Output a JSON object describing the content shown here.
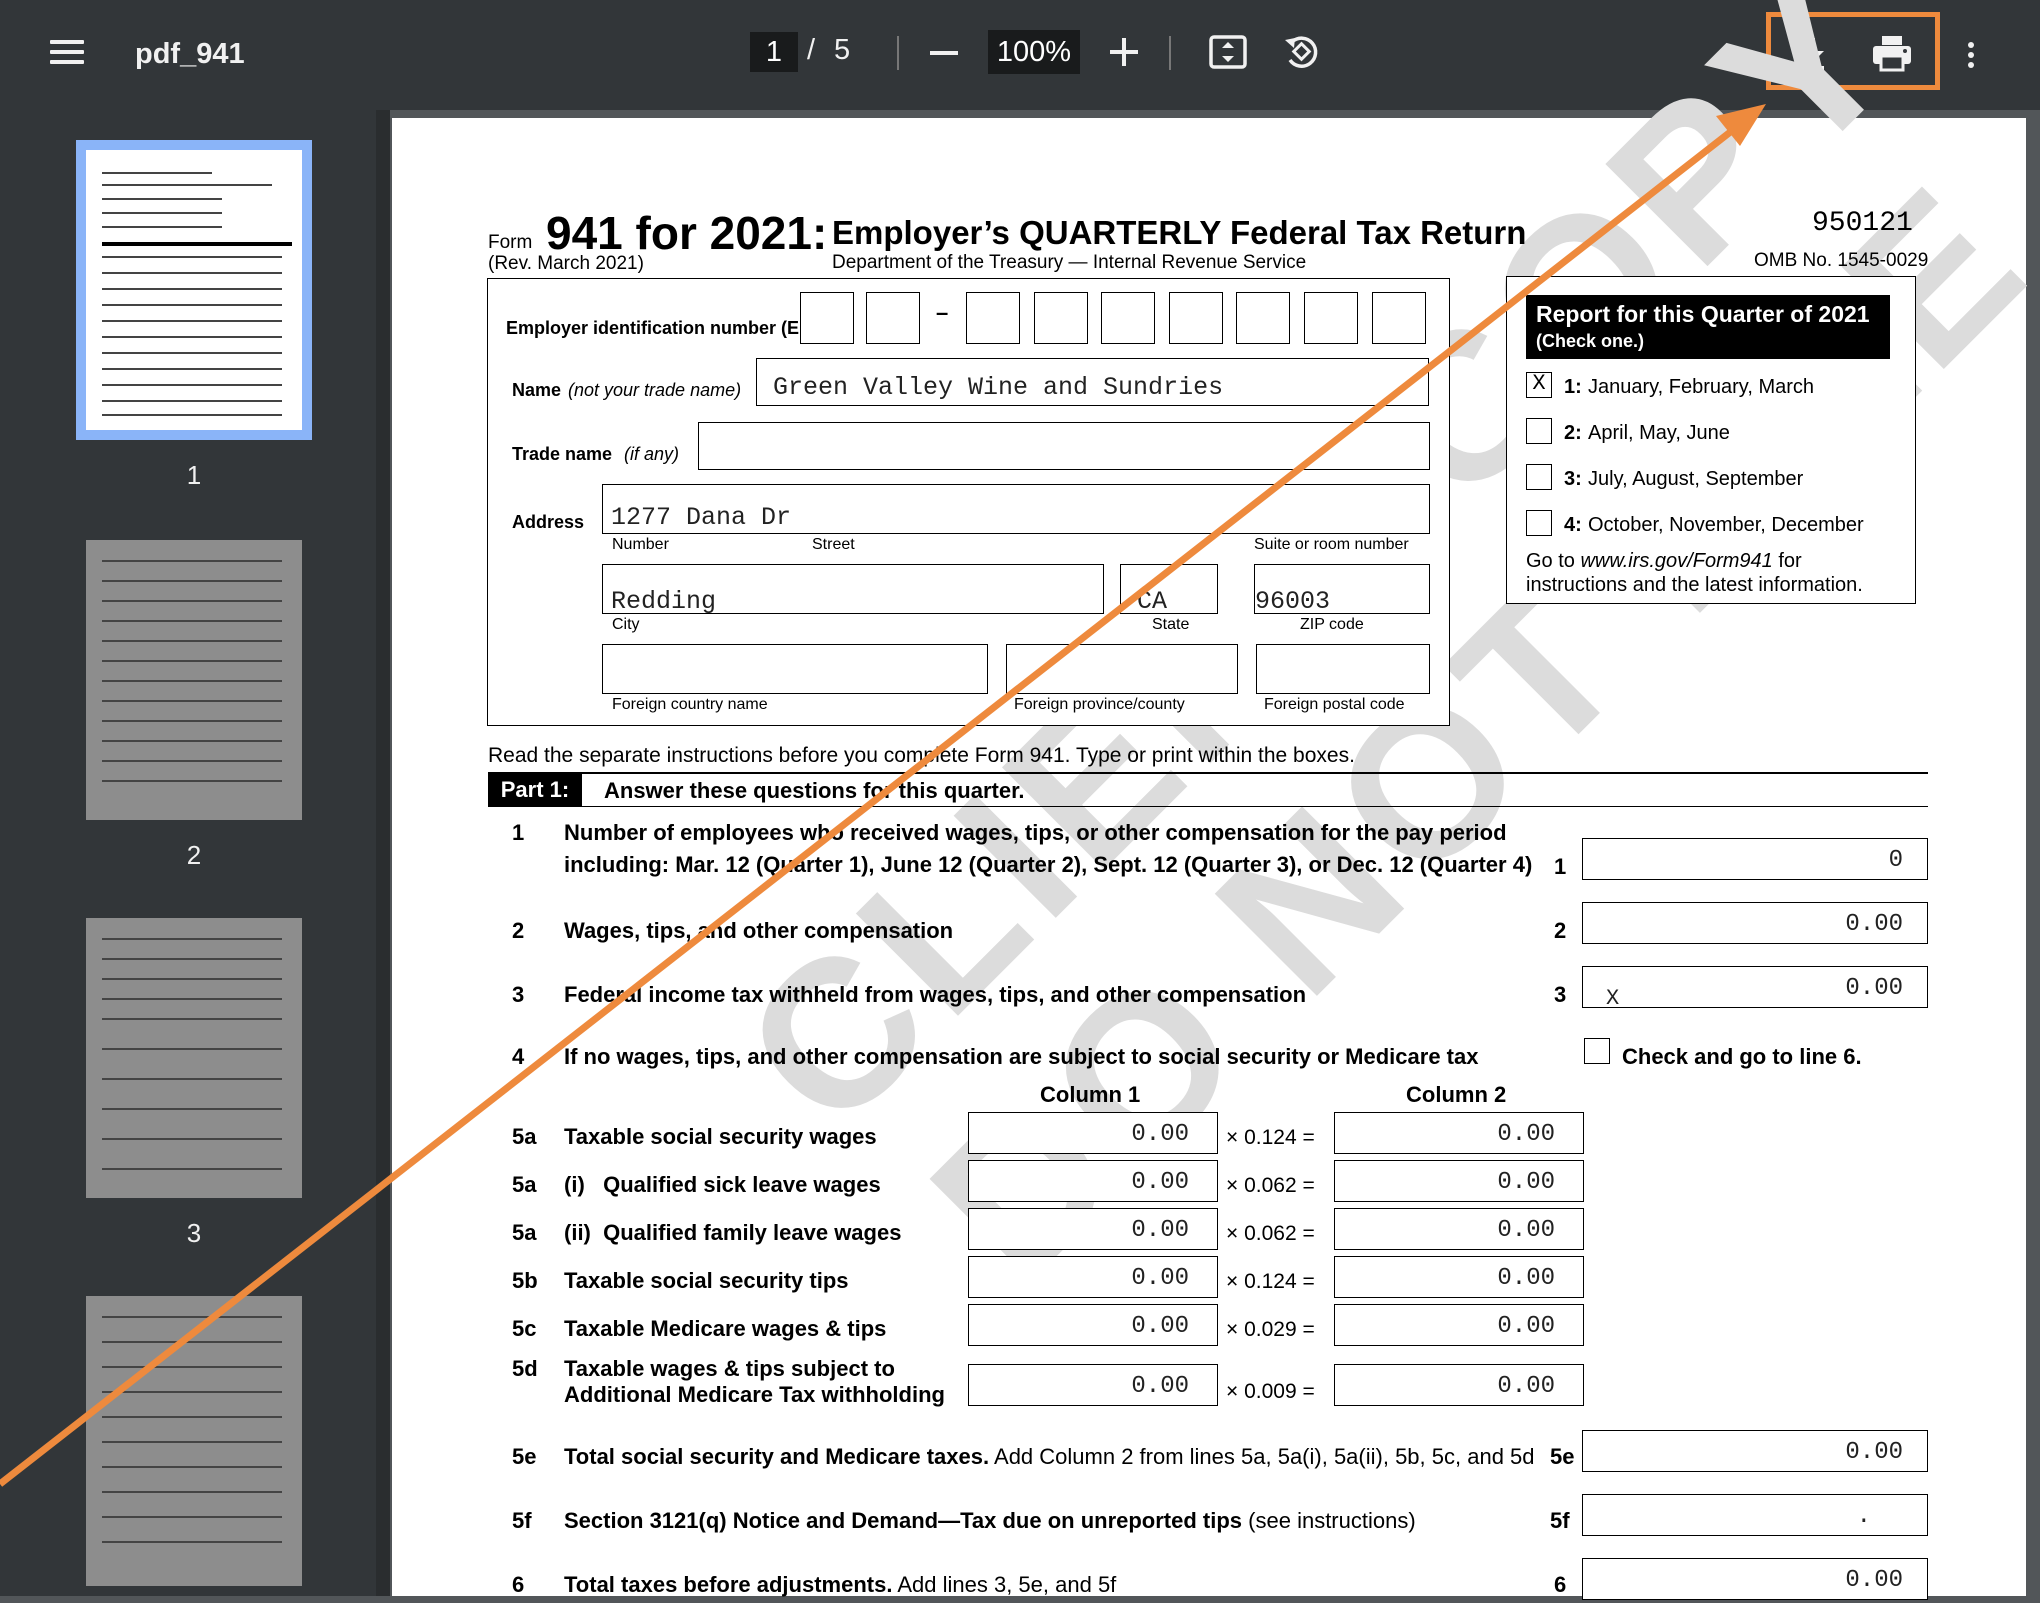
{
  "toolbar": {
    "title": "pdf_941",
    "page_current": "1",
    "page_sep": "/",
    "page_total": "5",
    "zoom": "100%",
    "accent_color": "#ee8a3d"
  },
  "thumbnails": [
    "1",
    "2",
    "3"
  ],
  "form": {
    "form_word": "Form",
    "form_number": "941 for 2021:",
    "title": "Employer’s QUARTERLY Federal Tax Return",
    "rev": "(Rev. March 2021)",
    "dept": "Department of the Treasury — Internal Revenue Service",
    "code": "950121",
    "omb": "OMB No. 1545-0029",
    "ein_label": "Employer identification number (EIN)",
    "ein_dash": "–",
    "name_label": "Name",
    "name_label_note": "(not your trade name)",
    "name_value": "Green Valley Wine and Sundries",
    "trade_label": "Trade name",
    "trade_note": "(if any)",
    "address_label": "Address",
    "address_value": "1277 Dana Dr",
    "number_label": "Number",
    "street_label": "Street",
    "suite_label": "Suite or room number",
    "city_value": "Redding",
    "state_value": "CA",
    "zip_value": "96003",
    "city_label": "City",
    "state_label": "State",
    "zip_label": "ZIP code",
    "foreign_country": "Foreign country name",
    "foreign_province": "Foreign province/county",
    "foreign_postal": "Foreign postal code",
    "quarter_header": "Report for this Quarter of 2021",
    "quarter_sub": "(Check one.)",
    "quarters": [
      {
        "num": "1:",
        "text": "January, February, March",
        "mark": "X"
      },
      {
        "num": "2:",
        "text": "April, May, June",
        "mark": ""
      },
      {
        "num": "3:",
        "text": "July, August, September",
        "mark": ""
      },
      {
        "num": "4:",
        "text": "October, November, December",
        "mark": ""
      }
    ],
    "goto_1": "Go to",
    "goto_url": "www.irs.gov/Form941",
    "goto_2": "for",
    "goto_3": "instructions and the latest information.",
    "read_instructions": "Read the separate instructions before you complete Form 941. Type or print within the boxes.",
    "part1_label": "Part 1:",
    "part1_title": "Answer these questions for this quarter.",
    "line1_num": "1",
    "line1_text_a": "Number of employees who received wages, tips, or other compensation for the pay period",
    "line1_text_b": "including: Mar. 12 (Quarter 1), June 12 (Quarter 2), Sept. 12 (Quarter 3), or Dec. 12 (Quarter 4)",
    "line1_value": "0",
    "line2_num": "2",
    "line2_text": "Wages, tips, and other compensation",
    "line2_value": "0.00",
    "line3_num": "3",
    "line3_text": "Federal income tax withheld from wages, tips, and other compensation",
    "line3_mark": "X",
    "line3_value": "0.00",
    "line4_num": "4",
    "line4_text": "If no wages, tips, and other compensation are subject to social security or Medicare tax",
    "line4_check": "Check and go to line 6.",
    "col1": "Column 1",
    "col2": "Column 2",
    "rows5": [
      {
        "num": "5a",
        "label": "Taxable social security wages",
        "c1": "0.00",
        "mult": "× 0.124 =",
        "c2": "0.00"
      },
      {
        "num": "5a",
        "label": "(i)   Qualified sick leave wages",
        "c1": "0.00",
        "mult": "× 0.062 =",
        "c2": "0.00"
      },
      {
        "num": "5a",
        "label": "(ii)  Qualified family leave wages",
        "c1": "0.00",
        "mult": "× 0.062 =",
        "c2": "0.00"
      },
      {
        "num": "5b",
        "label": "Taxable social security tips",
        "c1": "0.00",
        "mult": "× 0.124 =",
        "c2": "0.00"
      },
      {
        "num": "5c",
        "label": "Taxable Medicare wages & tips",
        "c1": "0.00",
        "mult": "× 0.029 =",
        "c2": "0.00"
      }
    ],
    "row5d_num": "5d",
    "row5d_a": "Taxable wages & tips subject to",
    "row5d_b": "Additional Medicare Tax withholding",
    "row5d_c1": "0.00",
    "row5d_mult": "× 0.009 =",
    "row5d_c2": "0.00",
    "line5e_num": "5e",
    "line5e_bold": "Total social security and Medicare taxes.",
    "line5e_rest": "Add Column 2 from lines 5a, 5a(i), 5a(ii), 5b, 5c, and 5d",
    "line5e_value": "0.00",
    "line5f_num": "5f",
    "line5f_bold": "Section 3121(q) Notice and Demand—Tax due on unreported tips",
    "line5f_rest": "(see instructions)",
    "line5f_value": ".",
    "line6_num": "6",
    "line6_bold": "Total taxes before adjustments.",
    "line6_rest": "Add lines 3, 5e, and 5f",
    "line6_value": "0.00",
    "watermark_1": "CLIENT COPY",
    "watermark_2": "DO NOT FILE"
  }
}
